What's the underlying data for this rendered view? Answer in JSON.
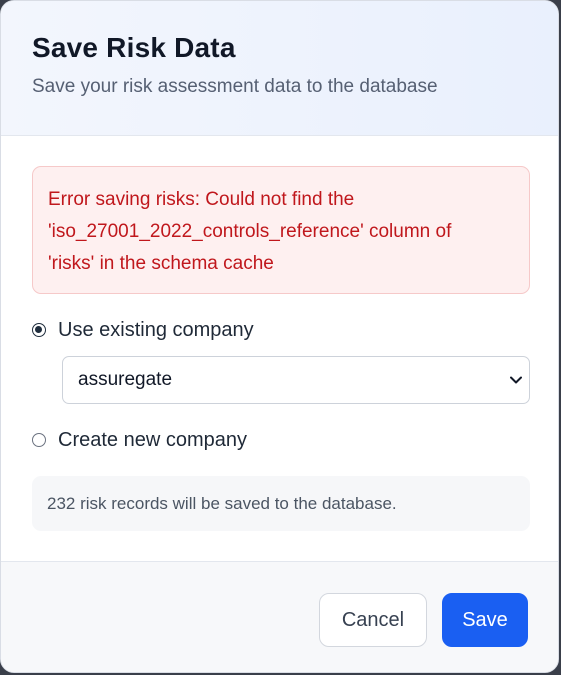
{
  "dialog": {
    "title": "Save Risk Data",
    "subtitle": "Save your risk assessment data to the database"
  },
  "error": {
    "line1": "Error saving risks: Could not find the",
    "line2": "'iso_27001_2022_controls_reference' column of",
    "line3": "'risks' in the schema cache"
  },
  "options": {
    "existing_label": "Use existing company",
    "existing_selected": true,
    "company_select_value": "assuregate",
    "new_label": "Create new company",
    "new_selected": false
  },
  "info": {
    "message": "232 risk records will be saved to the database."
  },
  "footer": {
    "cancel_label": "Cancel",
    "save_label": "Save"
  },
  "colors": {
    "primary": "#1a5ff2",
    "error_text": "#c0171c",
    "error_bg": "#fef0f0",
    "header_bg": "#eef3fd"
  },
  "icons": {
    "select_chevron": "chevron-down-icon"
  }
}
